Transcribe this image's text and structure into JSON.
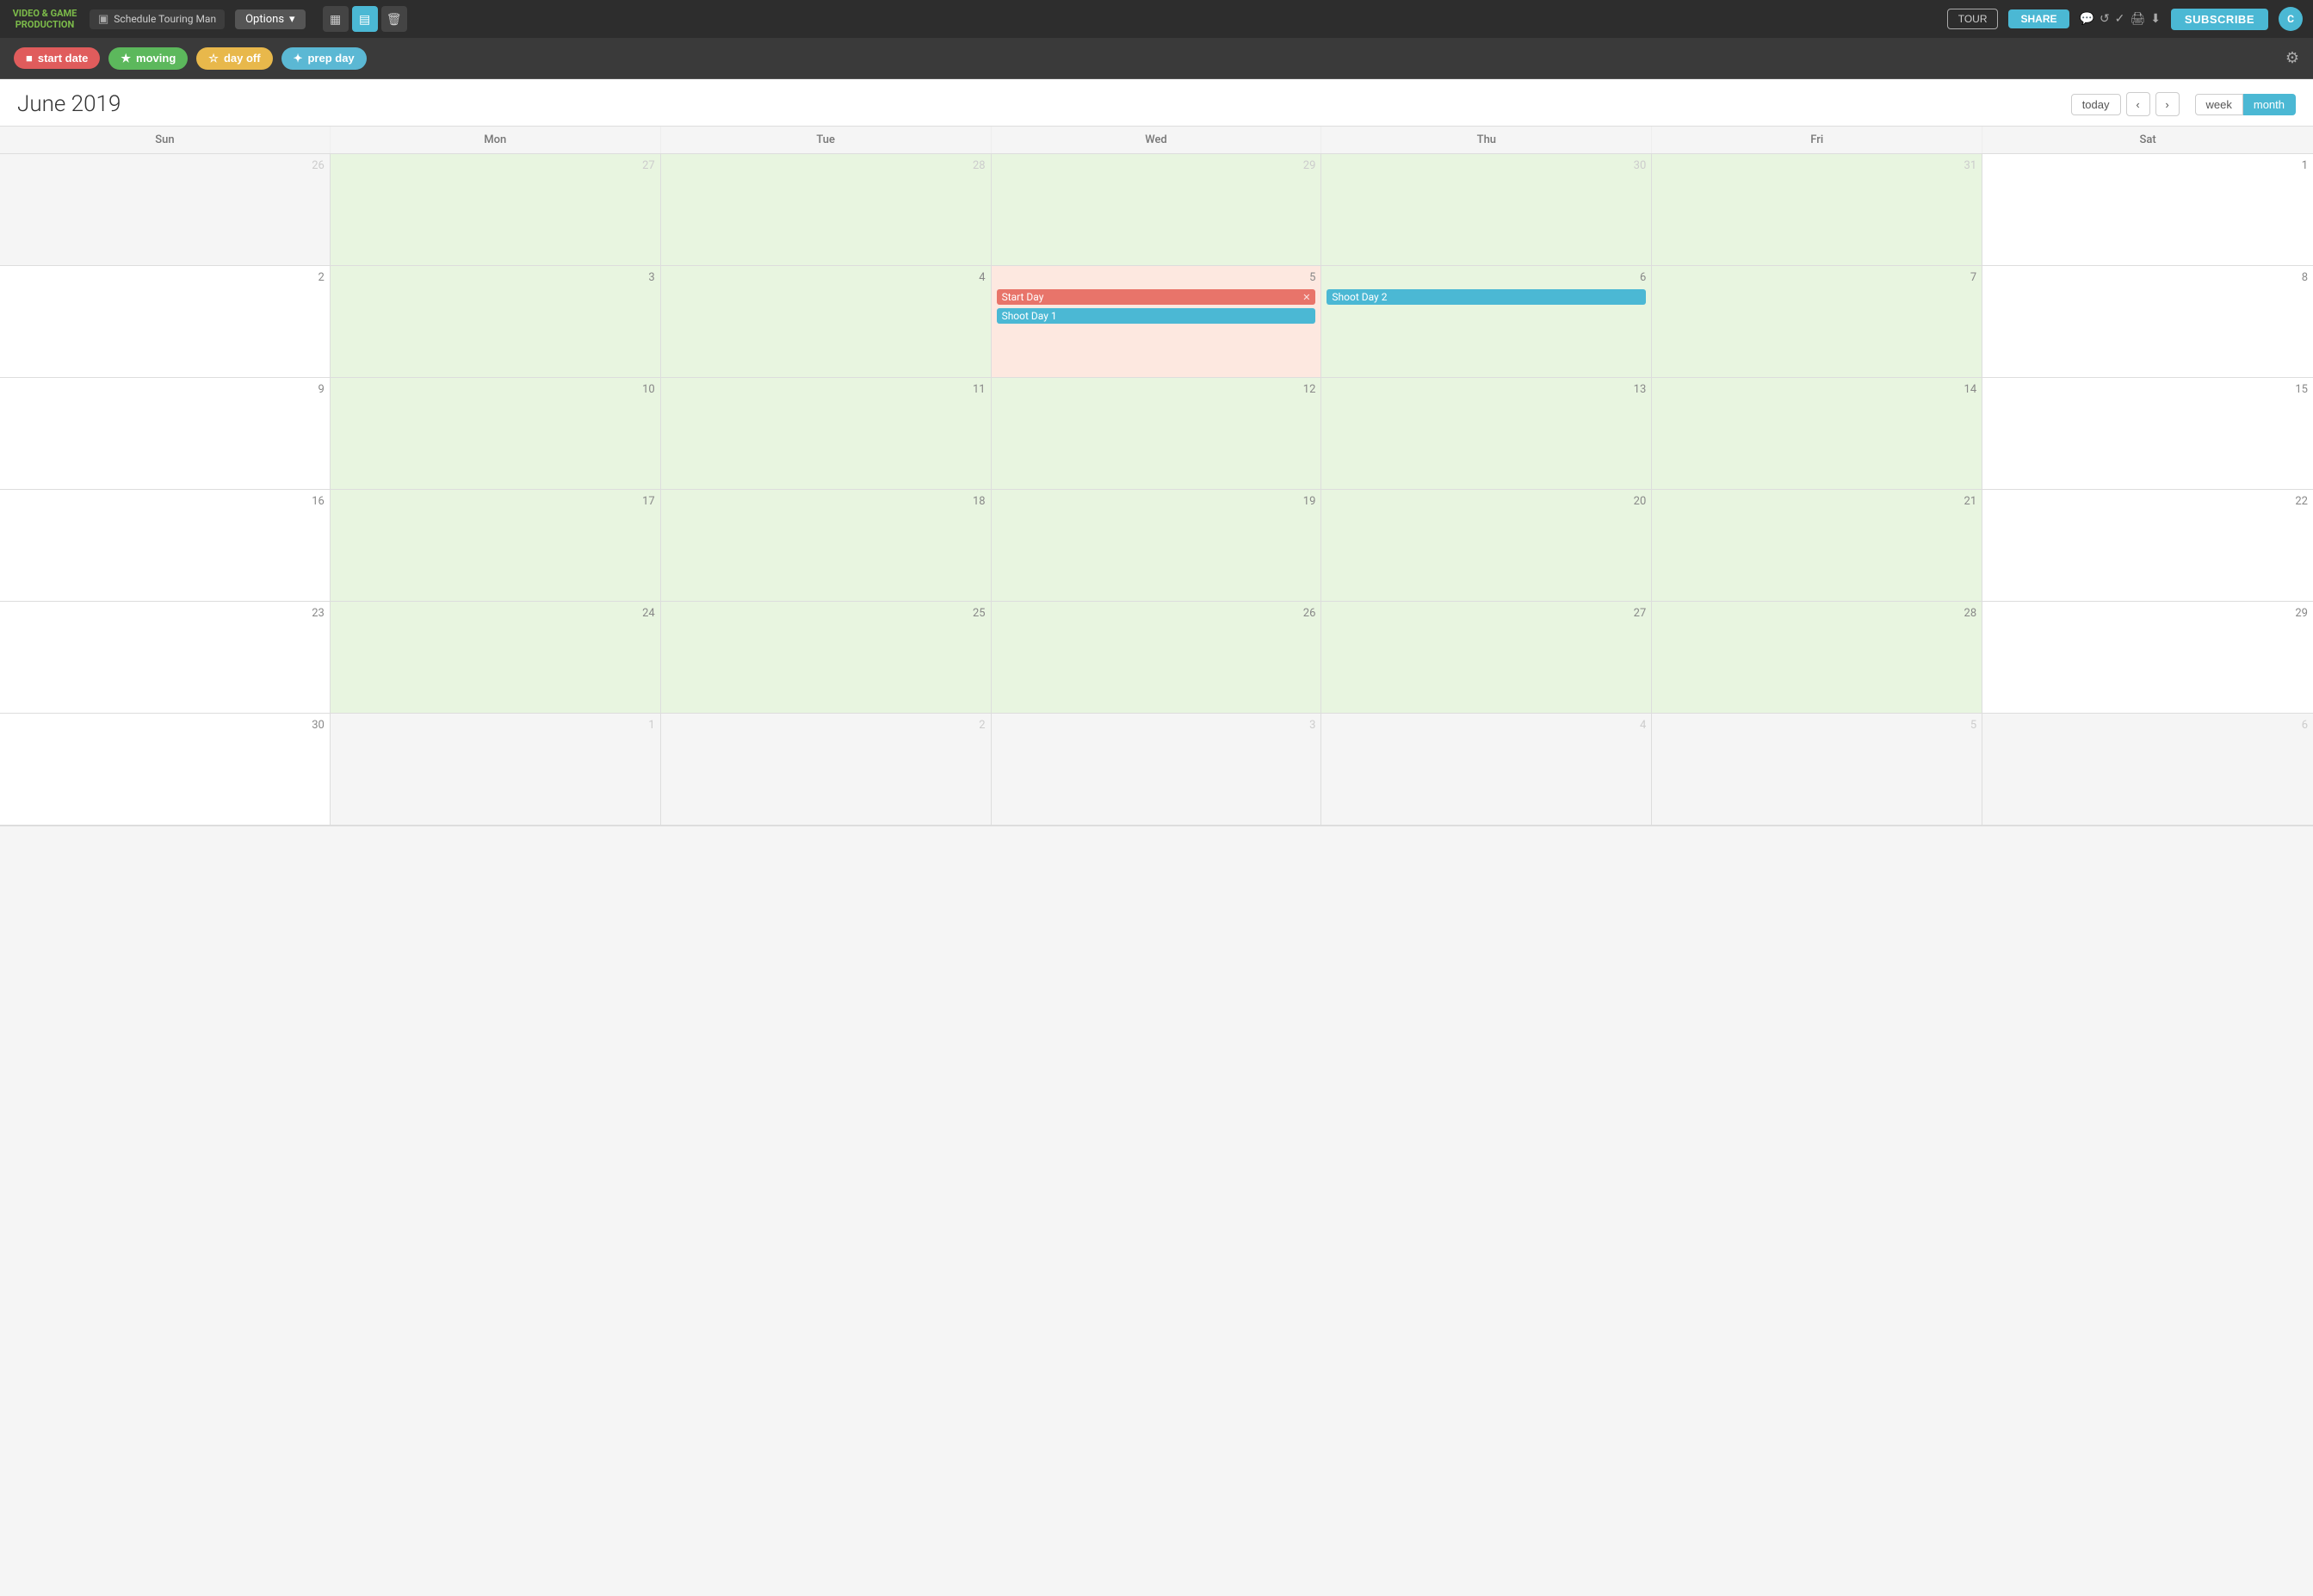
{
  "brand": {
    "line1": "VIDEO & GAME",
    "line2": "PRODUCTION"
  },
  "tab": {
    "icon": "▣",
    "label": "Schedule Touring Man"
  },
  "options": {
    "label": "Options"
  },
  "nav_icons": [
    {
      "name": "grid-icon",
      "symbol": "▦",
      "active": false
    },
    {
      "name": "table-icon",
      "symbol": "▤",
      "active": true
    },
    {
      "name": "trash-icon",
      "symbol": "🗑",
      "active": false
    }
  ],
  "tour_btn": "TOUR",
  "share_btn": "SHARE",
  "small_nav": [
    {
      "name": "comment-icon",
      "symbol": "💬"
    },
    {
      "name": "refresh-icon",
      "symbol": "↺"
    },
    {
      "name": "check-icon",
      "symbol": "✓"
    },
    {
      "name": "print-icon",
      "symbol": "🖨"
    },
    {
      "name": "download-icon",
      "symbol": "⬇"
    }
  ],
  "subscribe_btn": "SUBSCRIBE",
  "avatar": "C",
  "toolbar": {
    "start_date": "start date",
    "moving": "moving",
    "day_off": "day off",
    "prep_day": "prep day"
  },
  "calendar": {
    "title": "June 2019",
    "today_btn": "today",
    "week_btn": "week",
    "month_btn": "month",
    "days": [
      "Sun",
      "Mon",
      "Tue",
      "Wed",
      "Thu",
      "Fri",
      "Sat"
    ],
    "weeks": [
      [
        {
          "num": "26",
          "other": true,
          "bg": "grey"
        },
        {
          "num": "27",
          "other": true,
          "bg": "green"
        },
        {
          "num": "28",
          "other": true,
          "bg": "green"
        },
        {
          "num": "29",
          "other": true,
          "bg": "green"
        },
        {
          "num": "30",
          "other": true,
          "bg": "green"
        },
        {
          "num": "31",
          "other": true,
          "bg": "green"
        },
        {
          "num": "1",
          "other": false,
          "bg": "white"
        }
      ],
      [
        {
          "num": "2",
          "other": false,
          "bg": "white"
        },
        {
          "num": "3",
          "other": false,
          "bg": "green"
        },
        {
          "num": "4",
          "other": false,
          "bg": "green"
        },
        {
          "num": "5",
          "other": false,
          "bg": "red",
          "events": [
            {
              "label": "Start Day",
              "type": "salmon",
              "close": true
            },
            {
              "label": "Shoot Day 1",
              "type": "blue"
            }
          ]
        },
        {
          "num": "6",
          "other": false,
          "bg": "green",
          "events": [
            {
              "label": "Shoot Day 2",
              "type": "blue"
            }
          ]
        },
        {
          "num": "7",
          "other": false,
          "bg": "green"
        },
        {
          "num": "8",
          "other": false,
          "bg": "white"
        }
      ],
      [
        {
          "num": "9",
          "other": false,
          "bg": "white"
        },
        {
          "num": "10",
          "other": false,
          "bg": "green"
        },
        {
          "num": "11",
          "other": false,
          "bg": "green"
        },
        {
          "num": "12",
          "other": false,
          "bg": "green"
        },
        {
          "num": "13",
          "other": false,
          "bg": "green"
        },
        {
          "num": "14",
          "other": false,
          "bg": "green"
        },
        {
          "num": "15",
          "other": false,
          "bg": "white"
        }
      ],
      [
        {
          "num": "16",
          "other": false,
          "bg": "white"
        },
        {
          "num": "17",
          "other": false,
          "bg": "green"
        },
        {
          "num": "18",
          "other": false,
          "bg": "green"
        },
        {
          "num": "19",
          "other": false,
          "bg": "green"
        },
        {
          "num": "20",
          "other": false,
          "bg": "green"
        },
        {
          "num": "21",
          "other": false,
          "bg": "green"
        },
        {
          "num": "22",
          "other": false,
          "bg": "white"
        }
      ],
      [
        {
          "num": "23",
          "other": false,
          "bg": "white"
        },
        {
          "num": "24",
          "other": false,
          "bg": "green"
        },
        {
          "num": "25",
          "other": false,
          "bg": "green"
        },
        {
          "num": "26",
          "other": false,
          "bg": "green"
        },
        {
          "num": "27",
          "other": false,
          "bg": "green"
        },
        {
          "num": "28",
          "other": false,
          "bg": "green"
        },
        {
          "num": "29",
          "other": false,
          "bg": "white"
        }
      ],
      [
        {
          "num": "30",
          "other": false,
          "bg": "white"
        },
        {
          "num": "1",
          "other": true,
          "bg": "grey"
        },
        {
          "num": "2",
          "other": true,
          "bg": "grey"
        },
        {
          "num": "3",
          "other": true,
          "bg": "grey"
        },
        {
          "num": "4",
          "other": true,
          "bg": "grey"
        },
        {
          "num": "5",
          "other": true,
          "bg": "grey"
        },
        {
          "num": "6",
          "other": true,
          "bg": "grey"
        }
      ]
    ]
  }
}
